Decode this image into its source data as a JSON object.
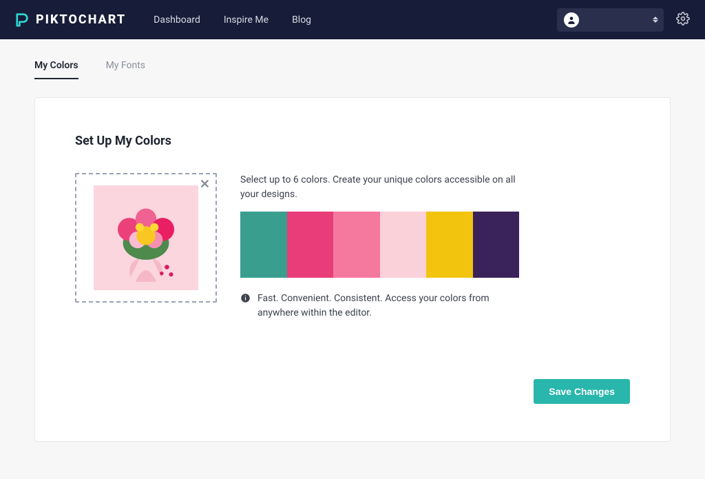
{
  "header": {
    "brand": "PIKTOCHART",
    "nav": [
      {
        "label": "Dashboard"
      },
      {
        "label": "Inspire Me"
      },
      {
        "label": "Blog"
      }
    ]
  },
  "tabs": [
    {
      "label": "My Colors",
      "active": true
    },
    {
      "label": "My Fonts",
      "active": false
    }
  ],
  "card": {
    "title": "Set Up My Colors",
    "instruction": "Select up to 6 colors. Create your unique colors accessible on all your designs.",
    "palette": [
      "#3a9e8f",
      "#e83d78",
      "#f5789f",
      "#fbd1d9",
      "#f2c40e",
      "#3a225a"
    ],
    "info": "Fast. Convenient. Consistent. Access your colors from anywhere within the editor.",
    "save_label": "Save Changes"
  }
}
